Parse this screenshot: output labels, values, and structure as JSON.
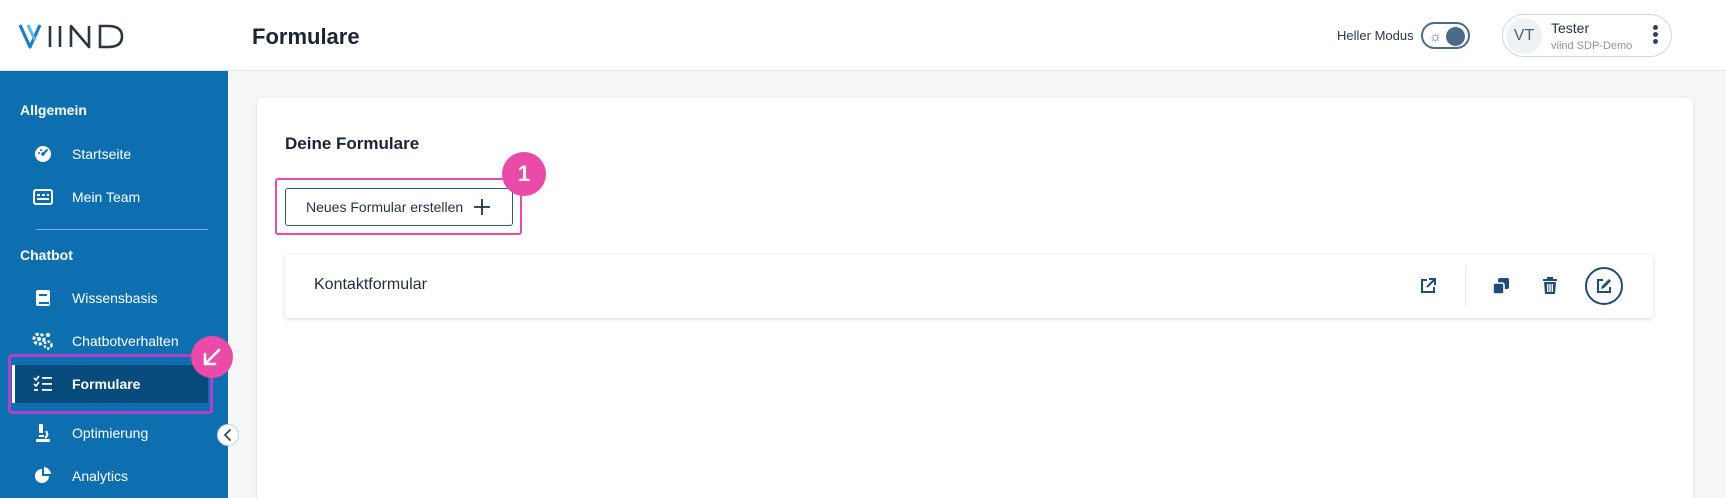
{
  "app": {
    "logo_text": "VIIND",
    "brand_color": "#0e6fb0",
    "accent_color": "#ea4ba8"
  },
  "header": {
    "title": "Formulare",
    "mode_label": "Heller Modus",
    "mode_icon": "sun-icon",
    "user": {
      "initials": "VT",
      "name": "Tester",
      "org": "viind SDP-Demo"
    }
  },
  "sidebar": {
    "sections": [
      {
        "label": "Allgemein",
        "items": [
          {
            "label": "Startseite",
            "icon": "dashboard-icon"
          },
          {
            "label": "Mein Team",
            "icon": "team-card-icon"
          }
        ]
      },
      {
        "label": "Chatbot",
        "items": [
          {
            "label": "Wissensbasis",
            "icon": "book-icon"
          },
          {
            "label": "Chatbotverhalten",
            "icon": "gears-icon"
          },
          {
            "label": "Formulare",
            "icon": "checklist-icon",
            "active": true
          },
          {
            "label": "Optimierung",
            "icon": "microscope-icon"
          },
          {
            "label": "Analytics",
            "icon": "pie-chart-icon"
          }
        ]
      }
    ]
  },
  "main": {
    "card_title": "Deine Formulare",
    "new_button_label": "Neues Formular erstellen",
    "forms": [
      {
        "name": "Kontaktformular"
      }
    ]
  },
  "annotations": {
    "step_marker": "1"
  }
}
